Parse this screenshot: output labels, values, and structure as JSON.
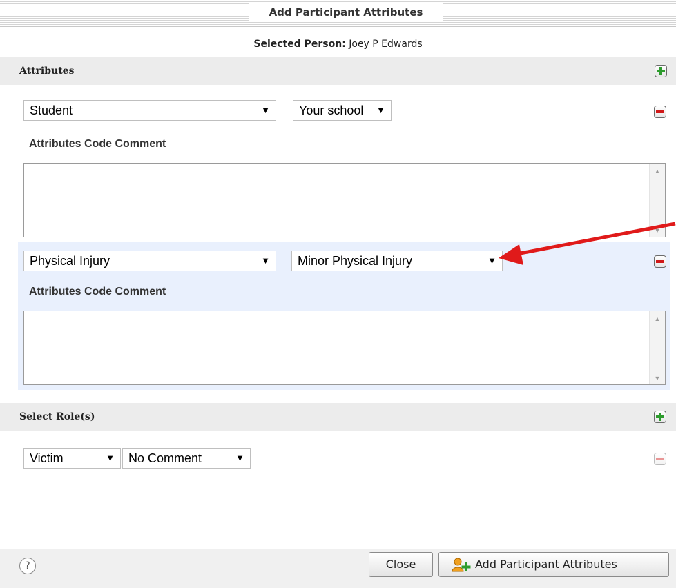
{
  "dialog": {
    "title": "Add Participant Attributes"
  },
  "selected_person": {
    "label": "Selected Person:",
    "value": "Joey P Edwards"
  },
  "attributes_section": {
    "header": "Attributes",
    "add_icon": "plus-icon",
    "rows": [
      {
        "attribute": "Student",
        "value": "Your school",
        "comment_label": "Attributes Code Comment",
        "comment": "",
        "remove_icon": "minus-icon"
      },
      {
        "attribute": "Physical Injury",
        "value": "Minor Physical Injury",
        "comment_label": "Attributes Code Comment",
        "comment": "",
        "remove_icon": "minus-icon"
      }
    ]
  },
  "roles_section": {
    "header": "Select Role(s)",
    "add_icon": "plus-icon",
    "rows": [
      {
        "role": "Victim",
        "comment": "No Comment",
        "remove_icon": "minus-icon"
      }
    ]
  },
  "footer": {
    "help_label": "?",
    "close_label": "Close",
    "add_label": "Add Participant Attributes",
    "add_icon": "add-user-icon"
  },
  "colors": {
    "annotation_arrow": "#e01a1a",
    "highlight_row": "#e9f0fd",
    "plus_green": "#2e9c2e",
    "minus_red": "#d01818"
  }
}
